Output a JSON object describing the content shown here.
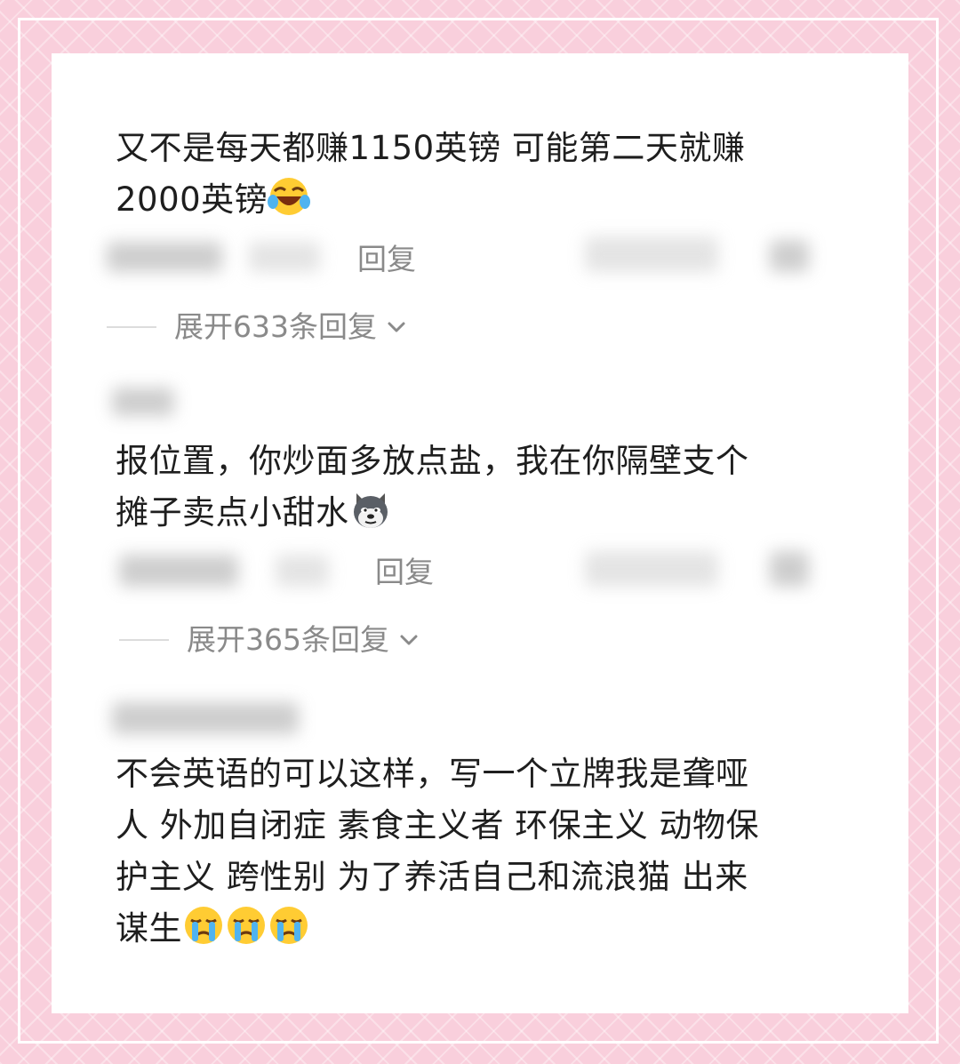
{
  "comments": [
    {
      "text_lines": [
        "又不是每天都赚1150英镑 可能第二天就赚",
        "2000英镑"
      ],
      "emojis": [
        "laughing-crying-emoji-icon"
      ],
      "reply_label": "回复",
      "expand_text": "展开633条回复"
    },
    {
      "text_lines": [
        "报位置，你炒面多放点盐，我在你隔壁支个",
        "摊子卖点小甜水"
      ],
      "emojis": [
        "doge-emoji-icon"
      ],
      "reply_label": "回复",
      "expand_text": "展开365条回复"
    },
    {
      "text_lines": [
        "不会英语的可以这样，写一个立牌我是聋哑",
        "人 外加自闭症 素食主义者  环保主义  动物保",
        "护主义  跨性别 为了养活自己和流浪猫 出来",
        "谋生"
      ],
      "emojis": [
        "crying-emoji-icon",
        "crying-emoji-icon",
        "crying-emoji-icon"
      ]
    }
  ],
  "colors": {
    "background": "#f9cfdc",
    "card": "#ffffff",
    "text": "#1e1e1e",
    "secondary_text": "#8a8a8a"
  },
  "icons": {
    "expand": "chevron-down-icon"
  }
}
